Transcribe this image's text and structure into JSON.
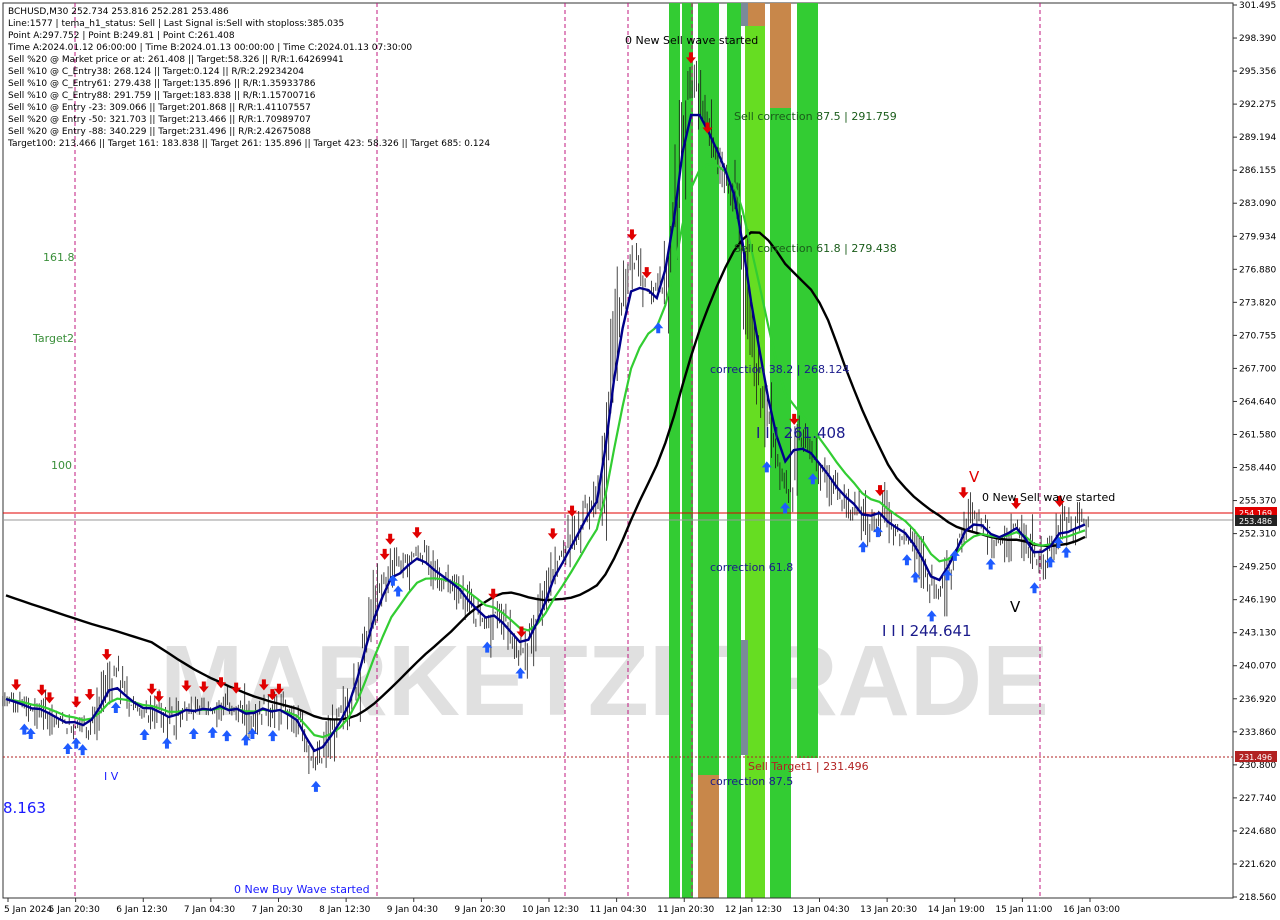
{
  "chart_data": {
    "type": "candlestick",
    "symbol_line": "BCHUSD,M30  252.734 253.816 252.281 253.486",
    "info_lines": [
      "Line:1577 | tema_h1_status: Sell | Last Signal is:Sell with stoploss:385.035",
      "Point A:297.752 | Point B:249.81 | Point C:261.408",
      "Time A:2024.01.12 06:00:00 | Time B:2024.01.13 00:00:00 | Time C:2024.01.13 07:30:00",
      "Sell %20 @ Market price or at: 261.408 || Target:58.326 || R/R:1.64269941",
      "Sell %10 @ C_Entry38: 268.124 || Target:0.124 || R/R:2.29234204",
      "Sell %10 @ C_Entry61: 279.438 || Target:135.896 || R/R:1.35933786",
      "Sell %10 @ C_Entry88: 291.759 || Target:183.838 || R/R:1.15700716",
      "Sell %10 @ Entry -23: 309.066 || Target:201.868 || R/R:1.41107557",
      "Sell %20 @ Entry -50: 321.703 || Target:213.466 || R/R:1.70989707",
      "Sell %20 @ Entry -88: 340.229 || Target:231.496 || R/R:2.42675088",
      "Target100: 213.466 || Target 161: 183.838 || Target 261: 135.896 || Target 423: 58.326 || Target 685: 0.124"
    ],
    "y_ticks": [
      "301.495",
      "298.390",
      "295.356",
      "292.275",
      "289.194",
      "286.155",
      "283.090",
      "279.934",
      "276.880",
      "273.820",
      "270.755",
      "267.700",
      "264.640",
      "261.580",
      "258.440",
      "255.370",
      "252.310",
      "249.250",
      "246.190",
      "243.130",
      "240.070",
      "236.920",
      "233.860",
      "230.800",
      "227.740",
      "224.680",
      "221.620",
      "218.560"
    ],
    "x_ticks": [
      "5 Jan 2024",
      "5 Jan 20:30",
      "6 Jan 12:30",
      "7 Jan 04:30",
      "7 Jan 20:30",
      "8 Jan 12:30",
      "9 Jan 04:30",
      "9 Jan 20:30",
      "10 Jan 12:30",
      "11 Jan 04:30",
      "11 Jan 20:30",
      "12 Jan 12:30",
      "13 Jan 04:30",
      "13 Jan 20:30",
      "14 Jan 19:00",
      "15 Jan 11:00",
      "16 Jan 03:00"
    ],
    "ylim": [
      218.56,
      301.495
    ],
    "price_tags": {
      "red": "254.169",
      "dark": "253.486",
      "target": "231.496"
    },
    "left_labels": {
      "fib161": "161.8",
      "target2": "Target2",
      "fib100": "100",
      "low_value": "8.163",
      "wave1": "I V"
    },
    "annotations": {
      "new_sell_top": "0 New Sell wave started",
      "sell_corr_875": "Sell correction 87.5 | 291.759",
      "sell_corr_618": "Sell correction 61.8 | 279.438",
      "corr_382": "correction 38.2 | 268.124",
      "point_c": "I I I 261.408",
      "new_sell_right": "0 New Sell wave started",
      "corr_618": "correction 61.8",
      "point_b": "I I I 244.641",
      "sell_target1": "Sell Target1 | 231.496",
      "corr_875": "correction 87.5",
      "new_buy": "0 New Buy Wave started",
      "v_right": "V",
      "v_top": "V",
      "wave_left": "I V"
    },
    "watermark": "MARKETZI TRADE",
    "series": [
      {
        "color": "#000000"
      },
      {
        "color": "#00008b"
      },
      {
        "color": "#32cd32"
      }
    ],
    "close_path": [
      237.0,
      236.5,
      236.2,
      235.8,
      236.0,
      235.3,
      234.8,
      234.4,
      234.9,
      234.3,
      235.6,
      237.5,
      239.3,
      238.2,
      236.6,
      236.0,
      235.7,
      236.1,
      235.4,
      234.9,
      235.8,
      236.4,
      235.8,
      236.3,
      235.9,
      236.7,
      235.6,
      236.2,
      235.2,
      235.8,
      236.5,
      235.6,
      236.1,
      235.1,
      234.5,
      232.0,
      230.9,
      232.9,
      234.7,
      236.1,
      238.0,
      241.2,
      244.7,
      247.2,
      248.6,
      250.0,
      249.0,
      250.2,
      250.6,
      249.3,
      248.3,
      247.8,
      247.2,
      246.5,
      245.1,
      244.5,
      243.8,
      244.9,
      243.4,
      242.3,
      241.4,
      242.7,
      245.6,
      248.0,
      250.5,
      251.0,
      252.6,
      254.1,
      255.6,
      256.5,
      265.2,
      272.9,
      276.1,
      278.2,
      275.4,
      274.7,
      273.4,
      279.5,
      286.1,
      293.8,
      294.6,
      291.1,
      288.1,
      286.2,
      284.1,
      281.6,
      274.8,
      268.4,
      264.7,
      260.5,
      257.8,
      256.7,
      261.1,
      260.3,
      259.4,
      257.8,
      256.8,
      255.5,
      254.9,
      254.4,
      253.1,
      253.9,
      254.5,
      252.6,
      252.3,
      251.9,
      250.3,
      248.7,
      246.7,
      247.7,
      250.5,
      252.3,
      254.3,
      253.8,
      253.0,
      251.5,
      251.7,
      252.7,
      253.3,
      251.0,
      249.3,
      250.7,
      251.7,
      253.5,
      252.6,
      253.2,
      253.5
    ]
  }
}
